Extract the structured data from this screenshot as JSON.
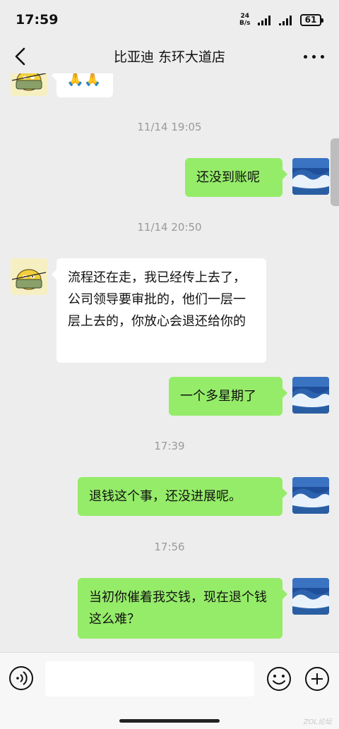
{
  "status_bar": {
    "time": "17:59",
    "net_speed_value": "24",
    "net_speed_unit": "B/s",
    "battery": "61"
  },
  "nav": {
    "title": "比亚迪  东环大道店"
  },
  "messages": [
    {
      "type": "left",
      "text": "🙏🙏"
    },
    {
      "type": "time",
      "text": "11/14 19:05"
    },
    {
      "type": "right",
      "text": "还没到账呢"
    },
    {
      "type": "time",
      "text": "11/14 20:50"
    },
    {
      "type": "left",
      "text": "流程还在走，我已经传上去了，公司领导要审批的，他们一层一层上去的，你放心会退还给你的"
    },
    {
      "type": "right",
      "text": "一个多星期了"
    },
    {
      "type": "time",
      "text": "17:39"
    },
    {
      "type": "right",
      "text": "退钱这个事，还没进展呢。"
    },
    {
      "type": "time",
      "text": "17:56"
    },
    {
      "type": "right",
      "text": "当初你催着我交钱，现在退个钱这么难？"
    }
  ],
  "input": {
    "placeholder": ""
  },
  "watermark": "ZOL论坛"
}
